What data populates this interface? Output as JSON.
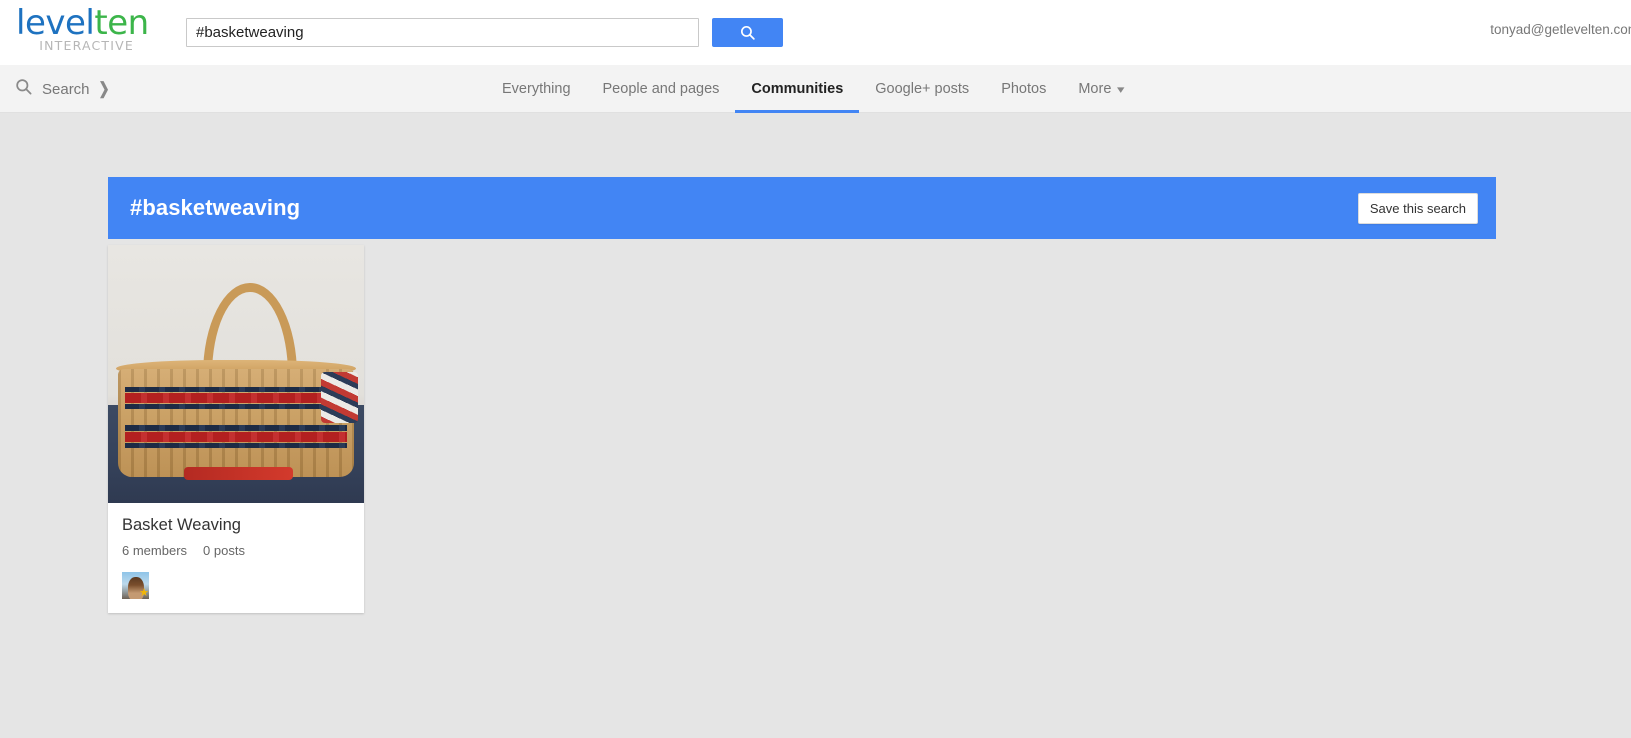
{
  "header": {
    "logo": {
      "part1": "level",
      "part2": "ten",
      "subtitle": "INTERACTIVE"
    },
    "search": {
      "value": "#basketweaving",
      "placeholder": "",
      "button_icon": "search-icon"
    },
    "user_email": "tonyad@getlevelten.com"
  },
  "navbar": {
    "left": {
      "icon": "search-icon",
      "label": "Search",
      "caret": "❯"
    },
    "tabs": [
      {
        "label": "Everything",
        "active": false
      },
      {
        "label": "People and pages",
        "active": false
      },
      {
        "label": "Communities",
        "active": true
      },
      {
        "label": "Google+ posts",
        "active": false
      },
      {
        "label": "Photos",
        "active": false
      },
      {
        "label": "More",
        "active": false,
        "caret": "▾"
      }
    ]
  },
  "banner": {
    "title": "#basketweaving",
    "save_button": "Save this search",
    "background_color": "#4285f4"
  },
  "results": [
    {
      "title": "Basket Weaving",
      "members": "6 members",
      "posts": "0 posts",
      "photo_alt": "woven basket with red and navy stripes",
      "avatars": [
        {
          "name": "member-avatar",
          "badge": "★"
        }
      ]
    }
  ],
  "colors": {
    "accent": "#4285f4",
    "page_background": "#e5e5e5",
    "navbar_background": "#f3f3f3",
    "logo_blue": "#1e72c0",
    "logo_green": "#3cb54a"
  }
}
